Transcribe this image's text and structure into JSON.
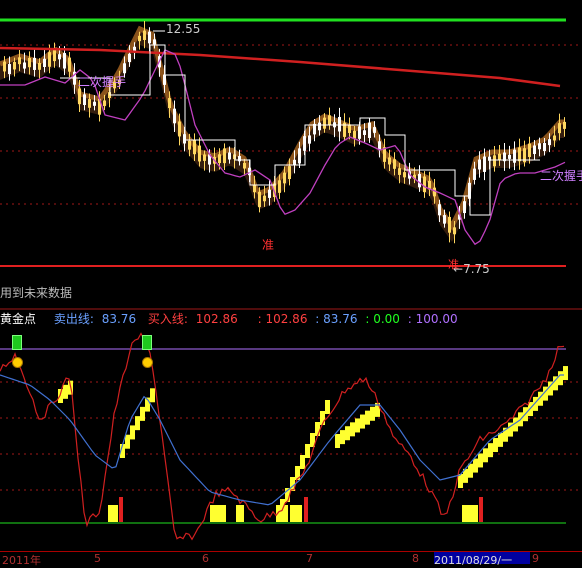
{
  "price_panel": {
    "high_label": "12.55",
    "low_label": "7.75",
    "low_arrow": "←",
    "marker_1": "准",
    "marker_2": "准",
    "erci_label_1": "二次握手",
    "erci_label_2": "二次握手"
  },
  "future_note": "用到未来数据",
  "indicator": {
    "name": "黄金点",
    "sell_label": "卖出线:",
    "sell_value": "83.76",
    "buy_label": "买入线:",
    "buy_value": "102.86",
    "v1": ": 102.86",
    "v2": ": 83.76",
    "v3": ": 0.00",
    "v4": ": 100.00",
    "colors": {
      "name": "#ffffff",
      "sell": "#6aa0ff",
      "buy": "#ff4040",
      "v1": "#ff4040",
      "v2": "#6aa0ff",
      "v3": "#20ff20",
      "v4": "#b070ff"
    }
  },
  "date_axis": {
    "ticks": [
      "2011年",
      "5",
      "6",
      "7",
      "8",
      "9"
    ],
    "cursor_date": "2011/08/29/一"
  },
  "colors": {
    "candle_up": "#ffd860",
    "candle_down": "#ffffff",
    "ma_long": "#d02020",
    "ma_purple": "#c040c0",
    "band": "#a06020",
    "gold_bar": "#ffff30",
    "signal": "#20c020"
  }
}
